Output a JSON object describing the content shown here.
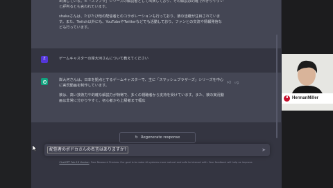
{
  "conversation": {
    "assistant_prev": {
      "paragraph1_tail": "出演している。ヒ「スマブラ」シリーズの解説者として出演しており、その解説は的確でわかりやすいと評判るとも言われています。",
      "paragraph2": "shakaさんは、たびたび他の配信者とのコラボレーションも行っており、彼の活躍が注目されています。また、Twitch以外にも、YouTubeやTwitterなどでも活動しており、ファンとの交流や情報発信なども行っています。"
    },
    "user": {
      "avatar_letter": "Z",
      "text": "ゲームキャスターの岸大河さんについて教えてください"
    },
    "assistant": {
      "paragraph1": "岸大河さんは、日本を拠点とするゲームキャスターで、主に「スマッシュブラザーズ」シリーズを中心に実況動画を制作しています。",
      "paragraph2": "彼は、高い技術力や的確な解説力が特徴で、多くの視聴者から支持を受けています。また、彼の実況動画は非常に分かりやすく、初心者から上級者まで幅広"
    }
  },
  "regenerate_label": "Regenerate response",
  "input": {
    "value": "配信者のポドカさんの名言はありますか?"
  },
  "footer": {
    "link": "ChatGPT Feb 13 Version",
    "text": ". Free Research Preview. Our goal is to make AI systems more natural and safe to interact with. Your feedback will help us improve."
  },
  "sponsor": {
    "name": "HermanMiller",
    "logo_letter": "H"
  },
  "colors": {
    "user_avatar": "#5436da",
    "assistant_avatar": "#10a37f",
    "sponsor_red": "#c8102e"
  }
}
